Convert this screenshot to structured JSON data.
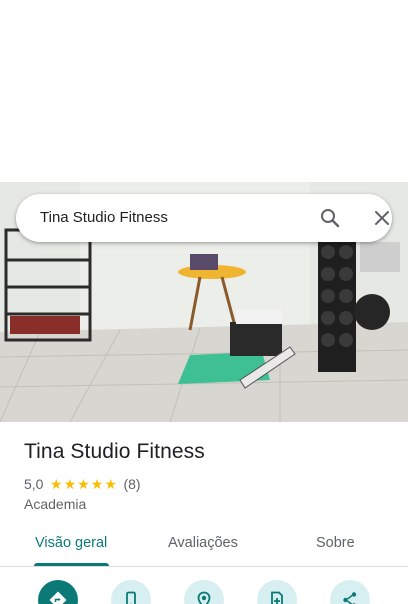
{
  "search": {
    "query": "Tina Studio Fitness"
  },
  "place": {
    "name": "Tina Studio Fitness",
    "rating": "5,0",
    "stars": 5,
    "review_count": "(8)",
    "category": "Academia"
  },
  "tabs": [
    {
      "label": "Visão geral",
      "active": true
    },
    {
      "label": "Avaliações",
      "active": false
    },
    {
      "label": "Sobre",
      "active": false
    }
  ],
  "actions": [
    {
      "icon": "directions-icon"
    },
    {
      "icon": "phone-icon"
    },
    {
      "icon": "location-pin-icon"
    },
    {
      "icon": "save-document-icon"
    },
    {
      "icon": "share-icon"
    }
  ],
  "colors": {
    "accent": "#0b7a77",
    "accent_light": "#d7eff0",
    "star": "#fbbc04"
  }
}
